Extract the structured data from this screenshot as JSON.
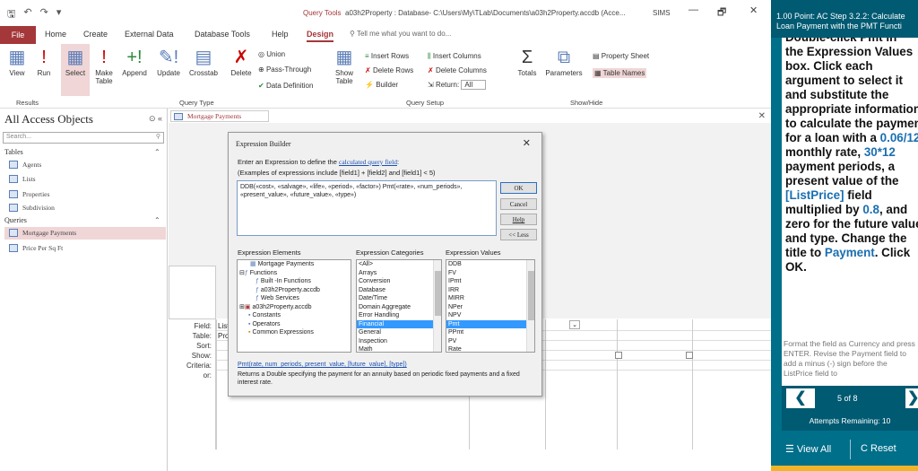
{
  "titlebar": {
    "query_tools": "Query Tools",
    "title": "a03h2Property : Database- C:\\Users\\My\\TLab\\Documents\\a03h2Property.accdb (Acce...",
    "user": "SIMS",
    "minimize": "—",
    "restore": "🗗",
    "close": "✕"
  },
  "ribbon_tabs": {
    "file": "File",
    "home": "Home",
    "create": "Create",
    "external": "External Data",
    "dbtools": "Database Tools",
    "help": "Help",
    "design": "Design",
    "tellme": "Tell me what you want to do..."
  },
  "ribbon": {
    "view": "View",
    "run": "Run",
    "results": "Results",
    "select": "Select",
    "make_table": "Make Table",
    "append": "Append",
    "update": "Update",
    "crosstab": "Crosstab",
    "delete": "Delete",
    "union": "Union",
    "passthrough": "Pass-Through",
    "data_definition": "Data Definition",
    "query_type": "Query Type",
    "show_table": "Show Table",
    "insert_rows": "Insert Rows",
    "delete_rows": "Delete Rows",
    "builder": "Builder",
    "insert_columns": "Insert Columns",
    "delete_columns": "Delete Columns",
    "return_label": "Return:",
    "return_value": "All",
    "query_setup": "Query Setup",
    "totals": "Totals",
    "parameters": "Parameters",
    "property_sheet": "Property Sheet",
    "table_names": "Table Names",
    "show_hide": "Show/Hide"
  },
  "nav": {
    "title": "All Access Objects",
    "search_placeholder": "Search...",
    "tables_header": "Tables",
    "tables": [
      "Agents",
      "Lists",
      "Properties",
      "Subdivision"
    ],
    "queries_header": "Queries",
    "queries": [
      "Mortgage Payments",
      "Price Per Sq Ft"
    ]
  },
  "doc": {
    "tab": "Mortgage Payments"
  },
  "grid": {
    "field": "Field:",
    "table": "Table:",
    "sort": "Sort:",
    "show": "Show:",
    "criteria": "Criteria:",
    "or": "or:",
    "field_val": "List",
    "table_val": "Pro"
  },
  "dialog": {
    "title": "Expression Builder",
    "close": "✕",
    "instr_prefix": "Enter an Expression to define the ",
    "instr_link": "calculated query field",
    "instr_suffix": ":",
    "examples": "(Examples of expressions include [field1] + [field2] and [field1] < 5)",
    "expression": "DDB(«cost», «salvage», «life», «period», «factor») Pmt(«rate», «num_periods», «present_value», «future_value», «type»)",
    "ok": "OK",
    "cancel": "Cancel",
    "help": "Help",
    "less": "<< Less",
    "elements_label": "Expression Elements",
    "categories_label": "Expression Categories",
    "values_label": "Expression Values",
    "elements": [
      "Mortgage Payments",
      "Functions",
      "Built -In Functions",
      "a03h2Property.accdb",
      "Web Services",
      "a03h2Property.accdb",
      "Constants",
      "Operators",
      "Common Expressions"
    ],
    "categories": [
      "<All>",
      "Arrays",
      "Conversion",
      "Database",
      "Date/Time",
      "Domain Aggregate",
      "Error Handling",
      "Financial",
      "General",
      "Inspection",
      "Math"
    ],
    "values": [
      "DDB",
      "FV",
      "IPmt",
      "IRR",
      "MIRR",
      "NPer",
      "NPV",
      "Pmt",
      "PPmt",
      "PV",
      "Rate"
    ],
    "selected_category": "Financial",
    "selected_value": "Pmt",
    "syntax": "Pmt(rate, num_periods, present_value, [future_value], [type])",
    "syntax_desc": "Returns a Double specifying the payment for an annuity based on periodic fixed payments and a fixed interest rate."
  },
  "panel": {
    "title_line1": "1.00 Point: AC Step 3.2.2: Calculate",
    "title_line2": "Loan Payment with the PMT Functi",
    "instr_clip": "Double-click Pmt in",
    "instr_1": "the Expression Values box. Click each argument to select it and substitute the appropriate information to calculate the payment for a loan with a ",
    "rate": "0.06/12",
    "instr_2": " monthly rate, ",
    "periods": "30*12",
    "instr_3": " payment periods, a present value of the ",
    "listprice": "[ListPrice]",
    "instr_4": " field multiplied by ",
    "mult": "0.8",
    "instr_5": ", and zero for the future value and type. Change the title to ",
    "payment": "Payment",
    "instr_6": ". Click OK.",
    "note": "Format the field as Currency and press ENTER. Revise the Payment field to add a minus (-) sign before the ListPrice field to",
    "prev": "❮",
    "page": "5 of 8",
    "next": "❯",
    "attempts": "Attempts Remaining: 10",
    "view_all": "☰ View All",
    "reset": "C Reset"
  }
}
